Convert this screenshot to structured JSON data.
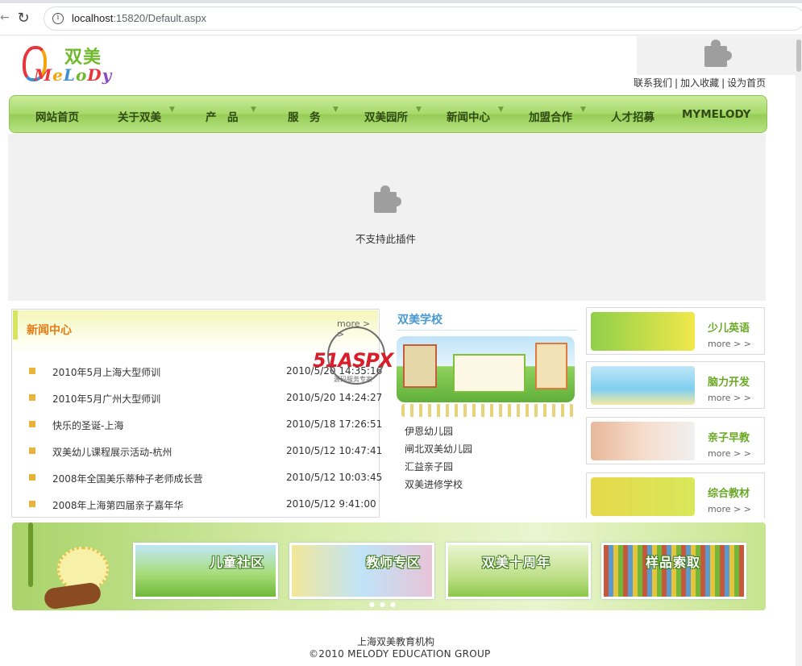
{
  "browser": {
    "url_host": "localhost",
    "url_rest": ":15820/Default.aspx"
  },
  "logo": {
    "cn": "双美",
    "en_letters": [
      "M",
      "e",
      "L",
      "o",
      "D",
      "y"
    ]
  },
  "toplinks": [
    "联系我们",
    "加入收藏",
    "设为首页"
  ],
  "nav": {
    "items": [
      {
        "label": "网站首页",
        "has_menu": false
      },
      {
        "label": "关于双美",
        "has_menu": true
      },
      {
        "label": "产　品",
        "has_menu": true
      },
      {
        "label": "服　务",
        "has_menu": true
      },
      {
        "label": "双美园所",
        "has_menu": true
      },
      {
        "label": "新闻中心",
        "has_menu": true
      },
      {
        "label": "加盟合作",
        "has_menu": true
      },
      {
        "label": "人才招募",
        "has_menu": false
      },
      {
        "label": "MYMELODY",
        "has_menu": false
      }
    ]
  },
  "plugin": {
    "message": "不支持此插件"
  },
  "news": {
    "title": "新闻中心",
    "more": "more > >",
    "rows": [
      {
        "title": "2010年5月上海大型师训",
        "date": "2010/5/20 14:35:16"
      },
      {
        "title": "2010年5月广州大型师训",
        "date": "2010/5/20 14:24:27"
      },
      {
        "title": "快乐的圣诞-上海",
        "date": "2010/5/18 17:26:51"
      },
      {
        "title": "双美幼儿课程展示活动-杭州",
        "date": "2010/5/12 10:47:41"
      },
      {
        "title": "2008年全国美乐蒂种子老师成长营",
        "date": "2010/5/12 10:03:45"
      },
      {
        "title": "2008年上海第四届亲子嘉年华",
        "date": "2010/5/12 9:41:00"
      }
    ]
  },
  "watermark": {
    "text": "51ASPX",
    "sub": "源码服务专家"
  },
  "school": {
    "title": "双美学校",
    "links": [
      "伊恩幼儿园",
      "闸北双美幼儿园",
      "汇益亲子园",
      "双美进修学校"
    ]
  },
  "cards": [
    {
      "title": "少儿英语",
      "more": "more > >"
    },
    {
      "title": "脑力开发",
      "more": "more > >"
    },
    {
      "title": "亲子早教",
      "more": "more > >"
    },
    {
      "title": "综合教材",
      "more": "more > >"
    }
  ],
  "banner": {
    "tiles": [
      "儿童社区",
      "教师专区",
      "双美十周年",
      "样品索取"
    ]
  },
  "footer": {
    "line1": "上海双美教育机构",
    "line2": "©2010 MELODY EDUCATION GROUP"
  },
  "colors": {
    "nav_green": "#a7d86a",
    "news_orange": "#e87a14",
    "school_blue": "#4a9ad0",
    "card_green": "#6aa826"
  }
}
